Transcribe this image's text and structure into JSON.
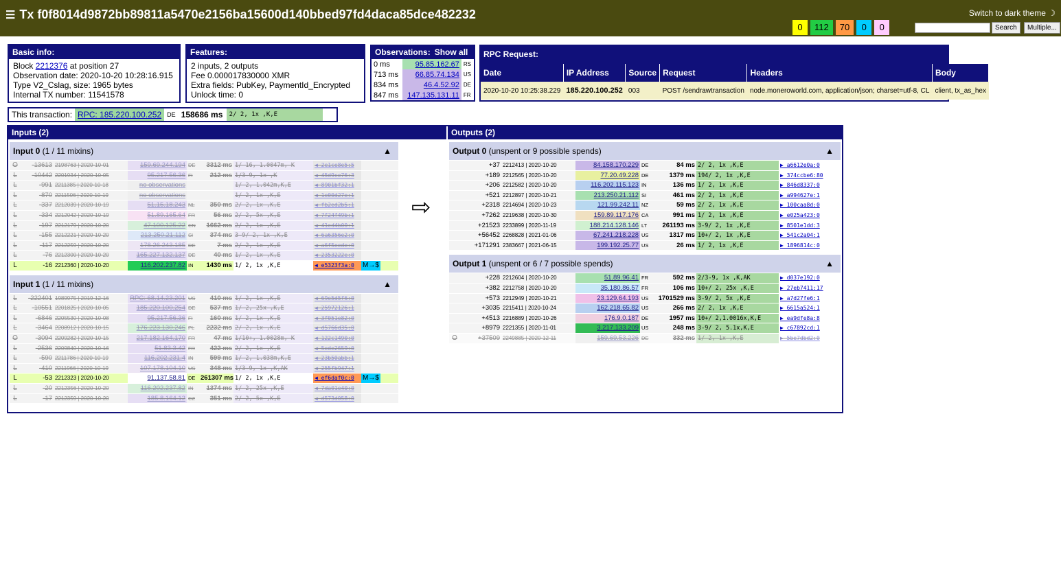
{
  "header": {
    "title": "Tx f0f8014d9872bb89811a5470e2156ba15600d140bbed97fd4daca85dce482232",
    "dark_theme": "Switch to dark theme",
    "counts": [
      "0",
      "112",
      "70",
      "0",
      "0"
    ],
    "count_colors": [
      "#ffff00",
      "#22cc44",
      "#ff9944",
      "#00ccff",
      "#ffccff"
    ],
    "search_btn": "Search",
    "multiple_btn": "Multiple..."
  },
  "basic": {
    "title": "Basic info:",
    "block_label": "Block",
    "block": "2212376",
    "position": "at position 27",
    "obs_date": "Observation date: 2020-10-20 10:28:16.915",
    "type": "Type V2_Cslag, size: 1965 bytes",
    "internal": "Internal TX number: 11541578"
  },
  "features": {
    "title": "Features:",
    "io": "2 inputs, 2 outputs",
    "fee": "Fee 0.000017830000 XMR",
    "extra": "Extra fields: PubKey, PaymentId_Encrypted",
    "unlock": "Unlock time: 0"
  },
  "observations": {
    "title": "Observations:",
    "show_all": "Show all",
    "rows": [
      {
        "ms": "0 ms",
        "ip": "95.85.162.67",
        "cc": "RS"
      },
      {
        "ms": "713 ms",
        "ip": "66.85.74.134",
        "cc": "US"
      },
      {
        "ms": "834 ms",
        "ip": "46.4.52.92",
        "cc": "DE"
      },
      {
        "ms": "847 ms",
        "ip": "147.135.131.11",
        "cc": "FR"
      }
    ]
  },
  "rpc": {
    "title": "RPC Request:",
    "headers": [
      "Date",
      "IP Address",
      "Source",
      "Request",
      "Headers",
      "Body"
    ],
    "row": [
      "2020-10-20",
      "10:25:38.229",
      "185.220.100.252",
      "003",
      "POST /sendrawtransaction",
      "node.moneroworld.com, application/json; charset=utf-8, CL",
      "client, tx_as_hex"
    ]
  },
  "this_tx": {
    "label": "This transaction:",
    "rpc": "RPC: 185.220.100.252",
    "cc": "DE",
    "ms": "158686 ms",
    "ring": "2/ 2, 1x ,K,E"
  },
  "inputs": {
    "title": "Inputs (2)",
    "groups": [
      {
        "title": "Input 0",
        "sub": "(1 / 11 mixins)",
        "rows": [
          {
            "t": "O",
            "o": "-13613",
            "b": "2198763 | 2020-10-01",
            "ip": "159.69.244.194",
            "cc": "DE",
            "ms": "3312 ms",
            "ring": "1/ 16, 1.0047m, K",
            "key": "◀ 2e1ce8e5:5",
            "dim": true
          },
          {
            "t": "L",
            "o": "-10442",
            "b": "2201934 | 2020-10-05",
            "ip": "95.217.56.36",
            "cc": "FI",
            "ms": "212 ms",
            "ring": "1/3-9, 1x ,K",
            "key": "◀ 45d9ce76:3",
            "dim": true
          },
          {
            "t": "L",
            "o": "-991",
            "b": "2211385 | 2020-10-18",
            "ip": "no observations",
            "cc": "",
            "ms": "",
            "ring": "1/ 2, 1.042m,K,E",
            "key": "◀ 8901bf32:1",
            "dim": true
          },
          {
            "t": "L",
            "o": "-870",
            "b": "2211506 | 2020-10-19",
            "ip": "no observations",
            "cc": "",
            "ms": "",
            "ring": "1/ 2, 1x ,K,E",
            "key": "◀ 1e00d27e:1",
            "dim": true
          },
          {
            "t": "L",
            "o": "-337",
            "b": "2212039 | 2020-10-19",
            "ip": "51.15.18.243",
            "cc": "NL",
            "ms": "350 ms",
            "ring": "2/ 2, 1x ,K,E",
            "key": "◀ fb2ed2b5:1",
            "dim": true
          },
          {
            "t": "L",
            "o": "-334",
            "b": "2212042 | 2020-10-19",
            "ip": "51.89.165.64",
            "cc": "FR",
            "ms": "56 ms",
            "ring": "2/ 2, 5x ,K,E",
            "key": "◀ 7f24f49b:1",
            "dim": true
          },
          {
            "t": "L",
            "o": "-197",
            "b": "2212179 | 2020-10-20",
            "ip": "47.100.125.22",
            "cc": "CN",
            "ms": "1662 ms",
            "ring": "2/ 2, 1x ,K,E",
            "key": "◀ 41ed4b00:1",
            "dim": true
          },
          {
            "t": "L",
            "o": "-155",
            "b": "2212221 | 2020-10-20",
            "ip": "213.250.21.112",
            "cc": "SI",
            "ms": "374 ms",
            "ring": "3-9/ 2, 1x ,K,E",
            "key": "◀ 6a6356e2:0",
            "dim": true
          },
          {
            "t": "L",
            "o": "-117",
            "b": "2212259 | 2020-10-20",
            "ip": "178.26.243.185",
            "cc": "DE",
            "ms": "7 ms",
            "ring": "2/ 2, 1x ,K,E",
            "key": "◀ a6f5eede:0",
            "dim": true
          },
          {
            "t": "L",
            "o": "-76",
            "b": "2212300 | 2020-10-20",
            "ip": "165.227.132.137",
            "cc": "DE",
            "ms": "40 ms",
            "ring": "1/ 2, 1x ,K,E",
            "key": "◀ 2353222e:0",
            "dim": true
          },
          {
            "t": "L",
            "o": "-16",
            "b": "2212360 | 2020-10-20",
            "ip": "116.202.237.82",
            "cc": "IN",
            "ms": "1430 ms",
            "ring": "1/ 2, 1x ,K,E",
            "key": "◀ e5323f3a:0",
            "dim": false,
            "hl": true,
            "tag": "M→$"
          }
        ]
      },
      {
        "title": "Input 1",
        "sub": "(1 / 11 mixins)",
        "rows": [
          {
            "t": "L",
            "o": "-222401",
            "b": "1989975 | 2019-12-16",
            "ip": "RPC: 68.14.23.201",
            "cc": "US",
            "ms": "410 ms",
            "ring": "1/ 2, 1x ,K,E",
            "key": "◀ 69e5d5f6:0",
            "dim": true
          },
          {
            "t": "L",
            "o": "-10551",
            "b": "2201825 | 2020-10-05",
            "ip": "185.220.100.254",
            "cc": "DE",
            "ms": "537 ms",
            "ring": "1/ 2, 25x ,K,E",
            "key": "◀ 25972126:1",
            "dim": true
          },
          {
            "t": "L",
            "o": "-6846",
            "b": "2205530 | 2020-10-08",
            "ip": "95.217.56.36",
            "cc": "FI",
            "ms": "160 ms",
            "ring": "1/ 2, 1x ,K,E",
            "key": "◀ 3f051e82:0",
            "dim": true
          },
          {
            "t": "L",
            "o": "-3464",
            "b": "2208912 | 2020-10-15",
            "ip": "176.223.130.246",
            "cc": "PL",
            "ms": "2232 ms",
            "ring": "2/ 2, 1x ,K,E",
            "key": "◀ d5766d35:0",
            "dim": true
          },
          {
            "t": "O",
            "o": "-3094",
            "b": "2209282 | 2020-10-15",
            "ip": "217.182.164.170",
            "cc": "FR",
            "ms": "47 ms",
            "ring": "1/10+, 1.0028m, K",
            "key": "◀ 122c1490:0",
            "dim": true
          },
          {
            "t": "L",
            "o": "-2536",
            "b": "2209840 | 2020-10-16",
            "ip": "51.83.3.42",
            "cc": "FR",
            "ms": "422 ms",
            "ring": "2/ 2, 1x ,K,E",
            "key": "◀ 5ede2659:0",
            "dim": true
          },
          {
            "t": "L",
            "o": "-590",
            "b": "2211786 | 2020-10-19",
            "ip": "116.202.231.4",
            "cc": "IN",
            "ms": "599 ms",
            "ring": "1/ 2, 1.038m,K,E",
            "key": "◀ 23b50abb:1",
            "dim": true
          },
          {
            "t": "L",
            "o": "-410",
            "b": "2211966 | 2020-10-19",
            "ip": "107.178.104.10",
            "cc": "US",
            "ms": "348 ms",
            "ring": "1/3-9, 1x ,K,AK",
            "key": "◀ 255fb947:1",
            "dim": true
          },
          {
            "t": "L",
            "o": "-53",
            "b": "2212323 | 2020-10-20",
            "ip": "91.137.58.81",
            "cc": "DE",
            "ms": "261307 ms",
            "ring": "1/ 2, 1x ,K,E",
            "key": "◀ ef6daf0c:0",
            "dim": false,
            "hl": true,
            "tag": "M→$"
          },
          {
            "t": "L",
            "o": "-20",
            "b": "2212356 | 2020-10-20",
            "ip": "116.202.237.82",
            "cc": "IN",
            "ms": "1374 ms",
            "ring": "1/ 2, 25x ,K,E",
            "key": "◀ 7da01e40:0",
            "dim": true
          },
          {
            "t": "L",
            "o": "-17",
            "b": "2212359 | 2020-10-20",
            "ip": "185.8.164.12",
            "cc": "CZ",
            "ms": "351 ms",
            "ring": "2/ 2, 5x ,K,E",
            "key": "◀ d573d058:0",
            "dim": true
          }
        ]
      }
    ]
  },
  "outputs": {
    "title": "Outputs (2)",
    "groups": [
      {
        "title": "Output 0",
        "sub": "(unspent or 9 possible spends)",
        "rows": [
          {
            "t": "",
            "o": "+37",
            "b": "2212413 | 2020-10-20",
            "ip": "84.158.170.229",
            "cc": "DE",
            "ms": "84 ms",
            "ring": "2/ 2, 1x ,K,E",
            "key": "▶ a6612e0a:0",
            "c": "#c9b8e8"
          },
          {
            "t": "",
            "o": "+189",
            "b": "2212565 | 2020-10-20",
            "ip": "77.20.49.228",
            "cc": "DE",
            "ms": "1379 ms",
            "ring": "194/ 2, 1x ,K,E",
            "key": "▶ 374ccbe6:80",
            "c": "#e8f0a0"
          },
          {
            "t": "",
            "o": "+206",
            "b": "2212582 | 2020-10-20",
            "ip": "116.202.115.123",
            "cc": "IN",
            "ms": "136 ms",
            "ring": "1/ 2, 1x ,K,E",
            "key": "▶ 846d8337:0",
            "c": "#b8d0f0"
          },
          {
            "t": "",
            "o": "+521",
            "b": "2212897 | 2020-10-21",
            "ip": "213.250.21.112",
            "cc": "SI",
            "ms": "461 ms",
            "ring": "2/ 2, 1x ,K,E",
            "key": "▶ a994627e:1",
            "c": "#a8e0b0"
          },
          {
            "t": "",
            "o": "+2318",
            "b": "2214694 | 2020-10-23",
            "ip": "121.99.242.11",
            "cc": "NZ",
            "ms": "59 ms",
            "ring": "2/ 2, 1x ,K,E",
            "key": "▶ 100caa8d:0",
            "c": "#b8d8f0"
          },
          {
            "t": "",
            "o": "+7262",
            "b": "2219638 | 2020-10-30",
            "ip": "159.89.117.176",
            "cc": "CA",
            "ms": "991 ms",
            "ring": "1/ 2, 1x ,K,E",
            "key": "▶ e025a423:0",
            "c": "#f0e0c0"
          },
          {
            "t": "",
            "o": "+21523",
            "b": "2233899 | 2020-11-19",
            "ip": "188.214.128.146",
            "cc": "LT",
            "ms": "261193 ms",
            "ring": "3-9/ 2, 1x ,K,E",
            "key": "▶ 8501e1dd:3",
            "c": "#d0f0d0"
          },
          {
            "t": "",
            "o": "+56452",
            "b": "2268828 | 2021-01-06",
            "ip": "67.241.218.228",
            "cc": "US",
            "ms": "1317 ms",
            "ring": "10+/ 2, 1x ,K,E",
            "key": "▶ 541c2a04:1",
            "c": "#c8b8e8"
          },
          {
            "t": "",
            "o": "+171291",
            "b": "2383667 | 2021-06-15",
            "ip": "199.192.25.77",
            "cc": "US",
            "ms": "26 ms",
            "ring": "1/ 2, 1x ,K,E",
            "key": "▶ 1896814c:0",
            "c": "#c8b8e8"
          }
        ]
      },
      {
        "title": "Output 1",
        "sub": "(unspent or 6 / 7 possible spends)",
        "rows": [
          {
            "t": "",
            "o": "+228",
            "b": "2212604 | 2020-10-20",
            "ip": "51.89.96.41",
            "cc": "FR",
            "ms": "592 ms",
            "ring": "2/3-9, 1x ,K,AK",
            "key": "▶ d037e192:0",
            "c": "#a8e0b0"
          },
          {
            "t": "",
            "o": "+382",
            "b": "2212758 | 2020-10-20",
            "ip": "35.180.86.57",
            "cc": "FR",
            "ms": "106 ms",
            "ring": "10+/ 2, 25x ,K,E",
            "key": "▶ 27eb7411:17",
            "c": "#c8e8f8"
          },
          {
            "t": "",
            "o": "+573",
            "b": "2212949 | 2020-10-21",
            "ip": "23.129.64.193",
            "cc": "US",
            "ms": "1701529 ms",
            "ring": "3-9/ 2, 5x ,K,E",
            "key": "▶ a7d27fe6:1",
            "c": "#f0c0e8"
          },
          {
            "t": "",
            "o": "+3035",
            "b": "2215411 | 2020-10-24",
            "ip": "162.218.65.82",
            "cc": "US",
            "ms": "266 ms",
            "ring": "2/ 2, 1x ,K,E",
            "key": "▶ 6615a524:1",
            "c": "#b8d0f0"
          },
          {
            "t": "",
            "o": "+4513",
            "b": "2216889 | 2020-10-26",
            "ip": "176.9.0.187",
            "cc": "DE",
            "ms": "1957 ms",
            "ring": "10+/ 2,1.0016x,K,E",
            "key": "▶ ea9dfe8a:8",
            "c": "#f0d0e0"
          },
          {
            "t": "",
            "o": "+8979",
            "b": "2221355 | 2020-11-01",
            "ip": "3.217.133.209",
            "cc": "US",
            "ms": "248 ms",
            "ring": "3-9/ 2, 5.1x,K,E",
            "key": "▶ c67892cd:1",
            "c": "#33bb55"
          },
          {
            "t": "O",
            "o": "+37509",
            "b": "2249885 | 2020-12-11",
            "ip": "159.69.53.226",
            "cc": "DE",
            "ms": "332 ms",
            "ring": "1/ 2, 1x ,K,E",
            "key": "▶ 5be7dbd2:0",
            "c": "#e0e0e0",
            "dim": true
          }
        ]
      }
    ]
  }
}
